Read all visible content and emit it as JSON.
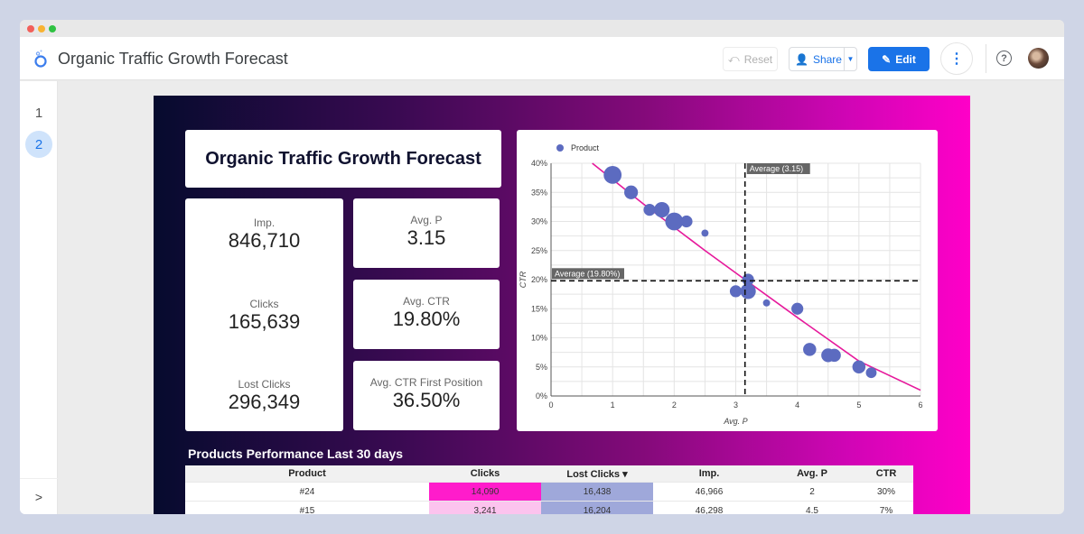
{
  "window": {
    "title": "Organic Traffic Growth Forecast"
  },
  "toolbar": {
    "reset_label": "Reset",
    "share_label": "Share",
    "edit_label": "Edit",
    "more_icon": "vertical-dots-icon",
    "help_icon": "help-circle-icon",
    "accent_color": "#1a73e8"
  },
  "sidebar": {
    "pages": [
      {
        "label": "1",
        "active": false
      },
      {
        "label": "2",
        "active": true
      }
    ],
    "toggle_glyph": ">"
  },
  "report": {
    "title": "Organic Traffic Growth Forecast",
    "kpis": {
      "imp": {
        "label": "Imp.",
        "value": "846,710"
      },
      "clicks": {
        "label": "Clicks",
        "value": "165,639"
      },
      "lost_clicks": {
        "label": "Lost Clicks",
        "value": "296,349"
      },
      "avg_p": {
        "label": "Avg. P",
        "value": "3.15"
      },
      "avg_ctr": {
        "label": "Avg. CTR",
        "value": "19.80%"
      },
      "avg_ctr_first": {
        "label": "Avg. CTR First Position",
        "value": "36.50%"
      }
    },
    "table": {
      "title": "Products Performance Last 30 days",
      "columns": [
        "Product",
        "Clicks",
        "Lost Clicks",
        "Imp.",
        "Avg. P",
        "CTR"
      ],
      "sort_indicator": "▾",
      "rows": [
        [
          "#24",
          "14,090",
          "16,438",
          "46,966",
          "2",
          "30%"
        ],
        [
          "#15",
          "3,241",
          "16,204",
          "46,298",
          "4.5",
          "7%"
        ]
      ],
      "heat_colors": {
        "clicks_high": "#ff1ccb",
        "clicks_low": "#fcc3ee",
        "lost": "#9fa8da"
      }
    }
  },
  "chart_data": {
    "type": "scatter",
    "legend": [
      "Product"
    ],
    "legend_position": "top-left",
    "xlabel": "Avg. P",
    "ylabel": "CTR",
    "xlim": [
      0,
      6
    ],
    "ylim": [
      0,
      40
    ],
    "xticks": [
      "0",
      "1",
      "2",
      "3",
      "4",
      "5",
      "6"
    ],
    "yticks": [
      "0%",
      "5%",
      "10%",
      "15%",
      "20%",
      "25%",
      "30%",
      "35%",
      "40%"
    ],
    "grid": true,
    "point_color": "#5c6bc0",
    "trend_color": "#e6199b",
    "reference_lines": [
      {
        "axis": "x",
        "value": 3.15,
        "label": "Average (3.15)"
      },
      {
        "axis": "y",
        "value": 19.8,
        "label": "Average (19.80%)"
      }
    ],
    "points": [
      {
        "x": 1.0,
        "y": 38,
        "size": 3
      },
      {
        "x": 1.3,
        "y": 35,
        "size": 2.3
      },
      {
        "x": 1.6,
        "y": 32,
        "size": 2
      },
      {
        "x": 1.8,
        "y": 32,
        "size": 2.6
      },
      {
        "x": 2.0,
        "y": 30,
        "size": 3
      },
      {
        "x": 2.2,
        "y": 30,
        "size": 2
      },
      {
        "x": 2.5,
        "y": 28,
        "size": 1.2
      },
      {
        "x": 3.0,
        "y": 18,
        "size": 2
      },
      {
        "x": 3.2,
        "y": 20,
        "size": 2
      },
      {
        "x": 3.2,
        "y": 18,
        "size": 2.6
      },
      {
        "x": 3.5,
        "y": 16,
        "size": 1.2
      },
      {
        "x": 4.0,
        "y": 15,
        "size": 2
      },
      {
        "x": 4.2,
        "y": 8,
        "size": 2.2
      },
      {
        "x": 4.5,
        "y": 7,
        "size": 2.3
      },
      {
        "x": 4.6,
        "y": 7,
        "size": 2.2
      },
      {
        "x": 5.0,
        "y": 5,
        "size": 2.2
      },
      {
        "x": 5.2,
        "y": 4,
        "size": 1.8
      }
    ],
    "trend": [
      [
        0.67,
        40
      ],
      [
        1.5,
        33
      ],
      [
        2.5,
        25
      ],
      [
        3.15,
        20
      ],
      [
        4,
        13.5
      ],
      [
        5,
        6
      ],
      [
        6,
        1
      ]
    ]
  }
}
